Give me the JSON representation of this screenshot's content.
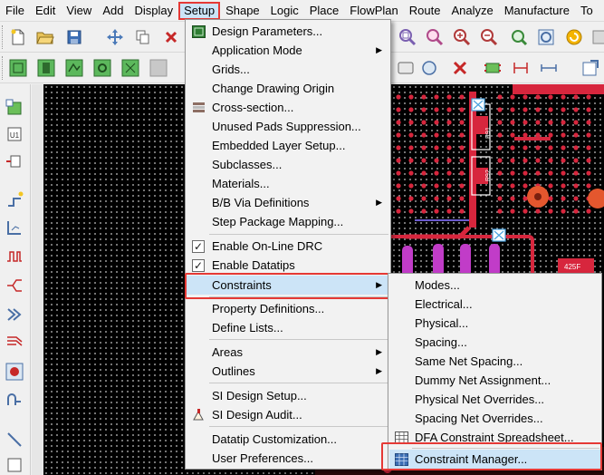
{
  "menubar": [
    "File",
    "Edit",
    "View",
    "Add",
    "Display",
    "Setup",
    "Shape",
    "Logic",
    "Place",
    "FlowPlan",
    "Route",
    "Analyze",
    "Manufacture",
    "To"
  ],
  "setup_menu": {
    "items": [
      {
        "label": "Design Parameters...",
        "icon": "design-parameters-icon"
      },
      {
        "label": "Application Mode",
        "submenu": true
      },
      {
        "label": "Grids..."
      },
      {
        "label": "Change Drawing Origin"
      },
      {
        "label": "Cross-section...",
        "icon": "cross-section-icon"
      },
      {
        "label": "Unused Pads Suppression..."
      },
      {
        "label": "Embedded Layer Setup..."
      },
      {
        "label": "Subclasses..."
      },
      {
        "label": "Materials..."
      },
      {
        "label": "B/B Via Definitions",
        "submenu": true
      },
      {
        "label": "Step Package Mapping..."
      },
      {
        "label": "Enable On-Line DRC",
        "checked": true
      },
      {
        "label": "Enable Datatips",
        "checked": true
      },
      {
        "label": "Constraints",
        "submenu": true,
        "highlighted": true
      },
      {
        "label": "Property Definitions..."
      },
      {
        "label": "Define Lists..."
      },
      {
        "label": "Areas",
        "submenu": true
      },
      {
        "label": "Outlines",
        "submenu": true
      },
      {
        "label": "SI Design Setup..."
      },
      {
        "label": "SI Design Audit...",
        "icon": "si-audit-icon"
      },
      {
        "label": "Datatip Customization..."
      },
      {
        "label": "User Preferences..."
      }
    ]
  },
  "constraints_submenu": {
    "items": [
      {
        "label": "Modes..."
      },
      {
        "label": "Electrical..."
      },
      {
        "label": "Physical..."
      },
      {
        "label": "Spacing..."
      },
      {
        "label": "Same Net Spacing..."
      },
      {
        "label": "Dummy Net Assignment..."
      },
      {
        "label": "Physical Net Overrides..."
      },
      {
        "label": "Spacing Net Overrides..."
      },
      {
        "label": "DFA Constraint Spreadsheet...",
        "icon": "spreadsheet-icon"
      },
      {
        "label": "Constraint Manager...",
        "icon": "constraint-manager-icon",
        "highlighted": true
      }
    ]
  },
  "canvas": {
    "refdes": [
      "R91",
      "R92",
      "425F"
    ]
  },
  "colors": {
    "menu_highlight": "#cce4f7",
    "callout_red": "#e53935",
    "pad_red": "#d7263d",
    "via_magenta": "#c13cc8",
    "component_outline": "#ffffff"
  }
}
